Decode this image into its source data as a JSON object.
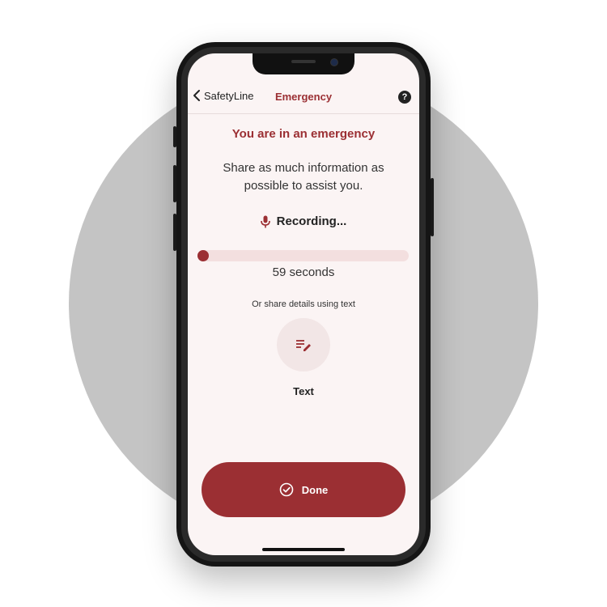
{
  "navbar": {
    "back_label": "SafetyLine",
    "title": "Emergency",
    "help_symbol": "?"
  },
  "content": {
    "headline": "You are in an emergency",
    "instructions": "Share as much information as possible to assist you.",
    "recording_label": "Recording...",
    "progress_fraction": 0.0,
    "seconds_text": "59 seconds",
    "alt_prompt": "Or share details using text",
    "text_button_label": "Text"
  },
  "actions": {
    "done_label": "Done"
  },
  "icons": {
    "back": "chevron-left-icon",
    "help": "question-circle-icon",
    "mic": "microphone-icon",
    "text": "text-edit-icon",
    "done": "check-circle-icon"
  },
  "colors": {
    "accent": "#9b2f33",
    "screen_background": "#fbf4f4",
    "progress_track": "#f3dfdf",
    "background_circle": "#c4c4c4"
  }
}
